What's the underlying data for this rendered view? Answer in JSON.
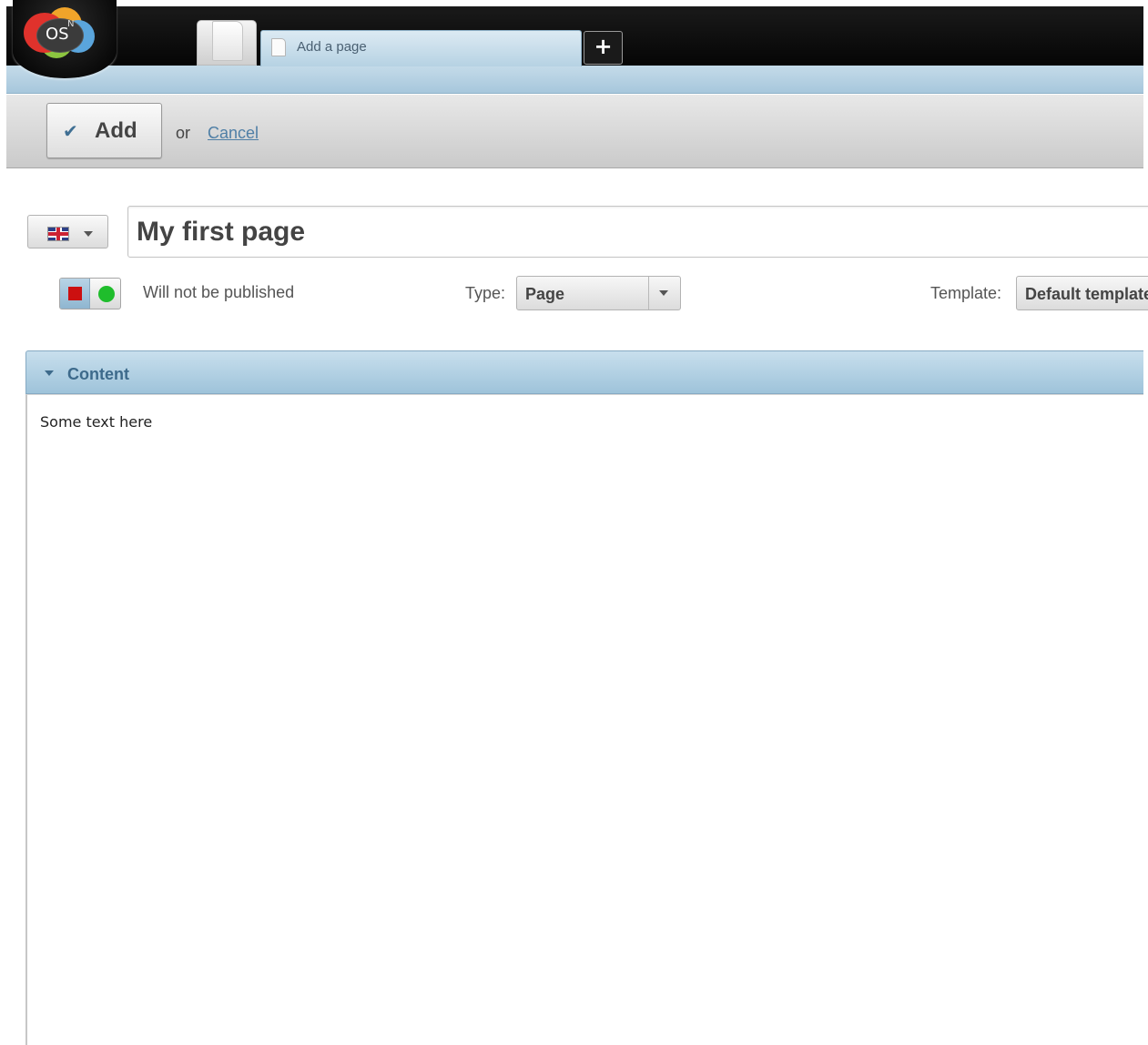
{
  "logo": {
    "text": "OS",
    "superscript": "N"
  },
  "tabs": {
    "home_icon": "home-page-icon",
    "active_label": "Add a page",
    "add_tab_label": "+"
  },
  "toolbar": {
    "add_check": "✔",
    "add_label": "Add",
    "or_text": "or",
    "cancel_label": "Cancel"
  },
  "page": {
    "language": "en-gb-flag",
    "title_value": "My first page",
    "publish_status": "Will not be published",
    "type_label": "Type:",
    "type_value": "Page",
    "template_label": "Template:",
    "template_value": "Default template"
  },
  "content_panel": {
    "title": "Content",
    "body_text": "Some text here"
  },
  "colors": {
    "accent_blue": "#9ec3da",
    "unpublished_red": "#cc1010",
    "published_green": "#1fbd2c",
    "link": "#4f7fa6"
  }
}
